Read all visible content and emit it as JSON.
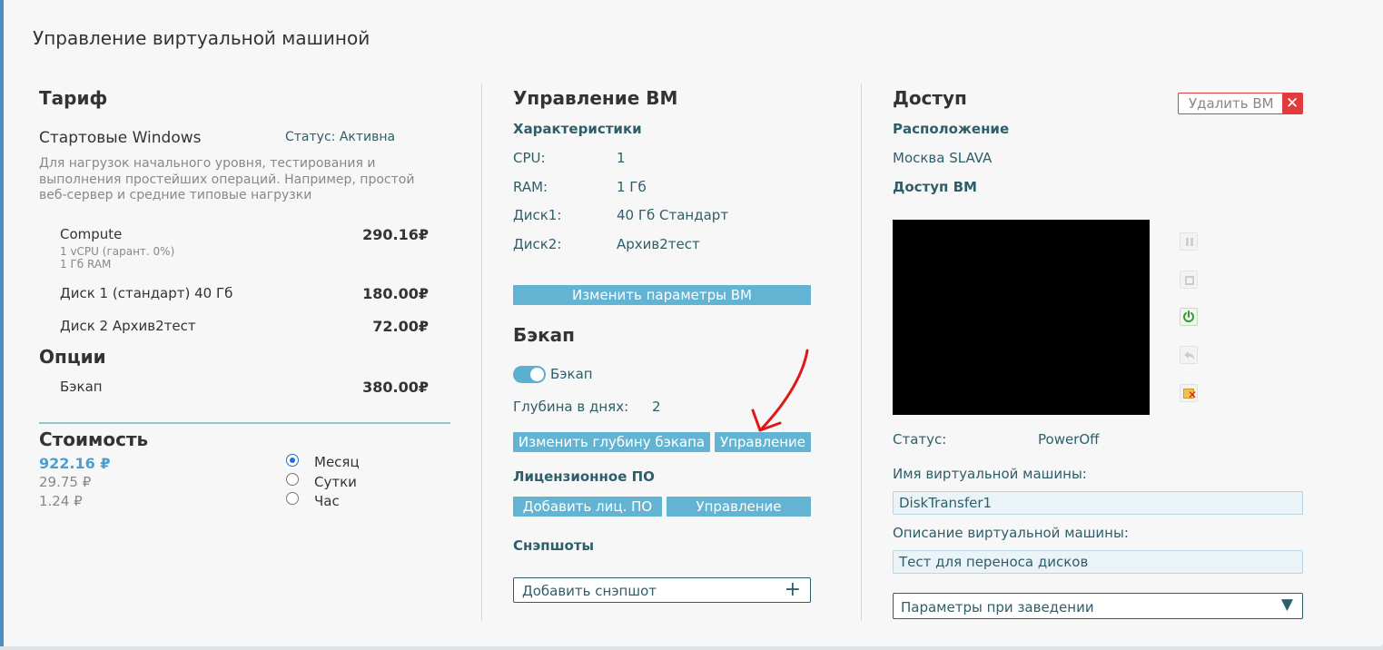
{
  "page_title": "Управление виртуальной машиной",
  "tariff": {
    "heading": "Тариф",
    "name": "Стартовые Windows",
    "status": "Статус: Активна",
    "description_lines": [
      "Для нагрузок начального уровня, тестирования и",
      "выполнения простейших операций. Например, простой",
      "веб-сервер и средние типовые нагрузки"
    ],
    "items": [
      {
        "name": "Compute",
        "sub1": "1 vCPU (гарант. 0%)",
        "sub2": "1 Гб RAM",
        "price": "290.16₽"
      },
      {
        "name": "Диск 1 (стандарт) 40 Гб",
        "price": "180.00₽"
      },
      {
        "name": "Диск 2 Архив2тест",
        "price": "72.00₽"
      }
    ],
    "options_heading": "Опции",
    "options": [
      {
        "name": "Бэкап",
        "price": "380.00₽"
      }
    ],
    "cost_heading": "Стоимость",
    "cost_month": "922.16 ₽",
    "cost_day": "29.75 ₽",
    "cost_hour": "1.24 ₽",
    "periods": [
      "Месяц",
      "Сутки",
      "Час"
    ],
    "selected_period": "Месяц"
  },
  "vm": {
    "heading": "Управление ВМ",
    "specs_heading": "Характеристики",
    "specs": [
      {
        "label": "CPU:",
        "value": "1"
      },
      {
        "label": "RAM:",
        "value": "1 Гб"
      },
      {
        "label": "Диск1:",
        "value": "40 Гб Стандарт"
      },
      {
        "label": "Диск2:",
        "value": "Архив2тест"
      }
    ],
    "change_params_button": "Изменить параметры ВМ",
    "backup_heading": "Бэкап",
    "backup_toggle_label": "Бэкап",
    "backup_enabled": true,
    "depth_label": "Глубина в днях:",
    "depth_value": "2",
    "change_depth_button": "Изменить глубину бэкапа",
    "backup_manage_button": "Управление",
    "license_heading": "Лицензионное ПО",
    "add_license_button": "Добавить лиц. ПО",
    "license_manage_button": "Управление",
    "snapshots_heading": "Снэпшоты",
    "add_snapshot_button": "Добавить снэпшот"
  },
  "access": {
    "heading": "Доступ",
    "delete_button": "Удалить ВМ",
    "location_heading": "Расположение",
    "location": "Москва SLAVA",
    "access_heading": "Доступ ВМ",
    "status_label": "Статус:",
    "status_value": "PowerOff",
    "vm_name_label": "Имя виртуальной машины:",
    "vm_name_value": "DiskTransfer1",
    "vm_desc_label": "Описание виртуальной машины:",
    "vm_desc_value": "Тест для переноса дисков",
    "params_select": "Параметры при заведении"
  },
  "colors": {
    "accent": "#63b4d3",
    "link_blue": "#4a9fd0",
    "danger": "#e23b3b",
    "arrow": "#e01818"
  }
}
